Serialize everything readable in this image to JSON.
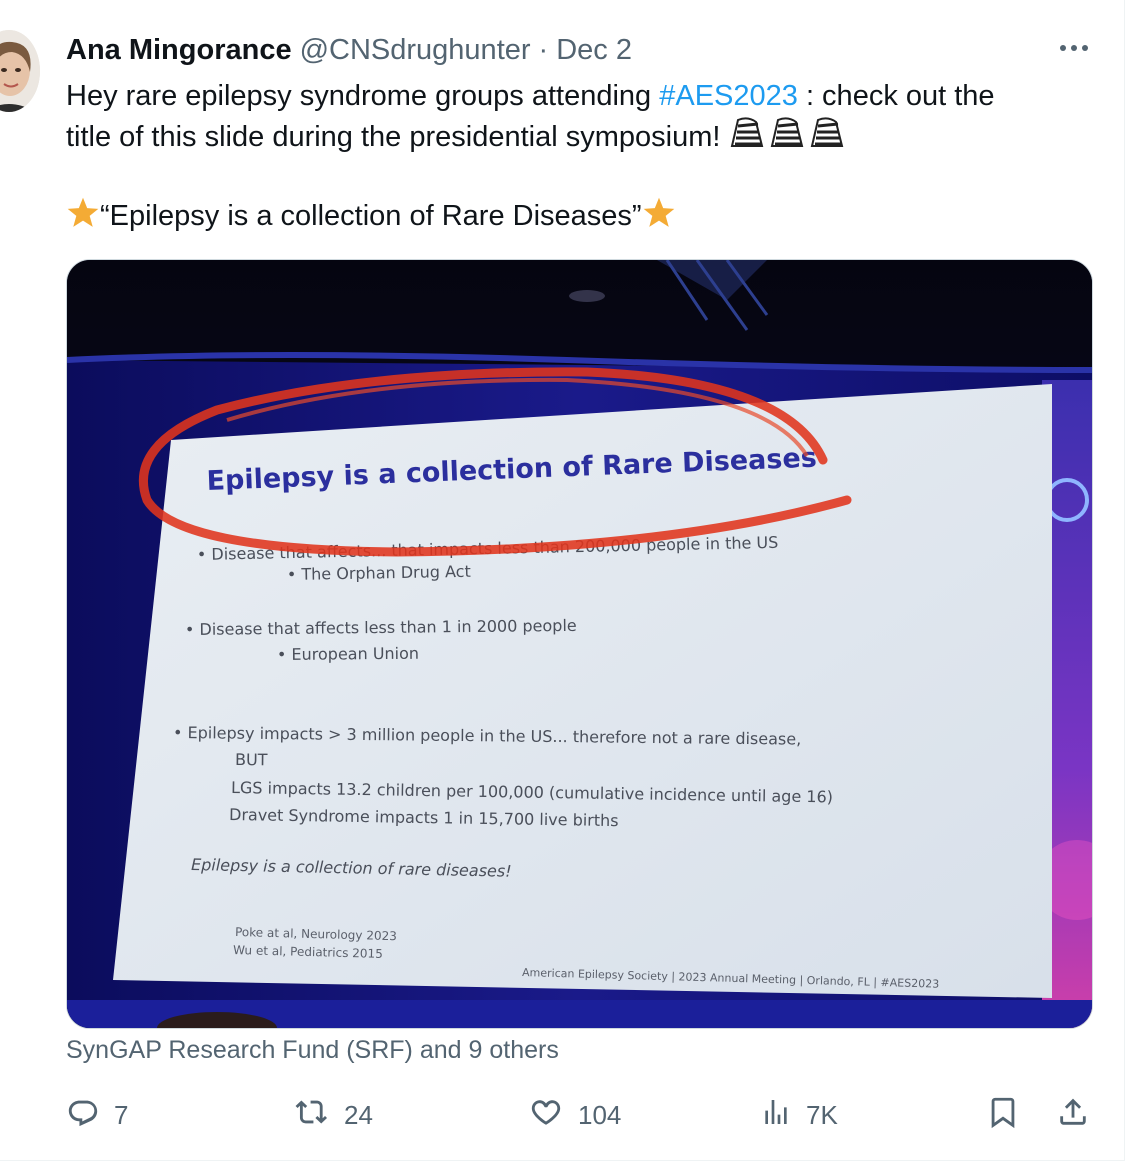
{
  "author": {
    "name": "Ana Mingorance",
    "handle": "@CNSdrughunter",
    "separator": "·",
    "date": "Dec 2"
  },
  "tweet": {
    "line1_before": "Hey rare epilepsy syndrome groups attending ",
    "hashtag": "#AES2023",
    "line1_after": " : check out the",
    "line2": "title of this slide during the presidential symposium! ",
    "quote": "“Epilepsy is a collection of Rare Diseases”"
  },
  "slide": {
    "title": "Epilepsy is a collection of Rare Diseases",
    "bullet1": "• Disease that affects... that impacts less than 200,000 people in the US",
    "bullet1_sub": "•  The Orphan Drug Act",
    "bullet2": "• Disease that affects less than 1 in 2000 people",
    "bullet2_sub": "•  European Union",
    "bullet3": "• Epilepsy impacts > 3 million people in the US... therefore not a rare disease,",
    "but": "BUT",
    "lgs": "LGS impacts 13.2 children per 100,000 (cumulative incidence until age 16)",
    "dravet": "Dravet Syndrome impacts 1 in 15,700 live births",
    "conclusion": "Epilepsy is a collection of rare diseases!",
    "ref1": "Poke at al, Neurology 2023",
    "ref2": "Wu et al, Pediatrics 2015",
    "footer": "American Epilepsy Society  |  2023 Annual Meeting  |  Orlando, FL  |  #AES2023"
  },
  "liked_by": "SynGAP Research Fund (SRF) and 9 others",
  "actions": {
    "replies": "7",
    "reposts": "24",
    "likes": "104",
    "views": "7K"
  },
  "colors": {
    "text": "#0f1419",
    "secondary": "#536471",
    "link": "#1d9bf0",
    "slide_title": "#2b2f9e",
    "marker": "#e0341c"
  },
  "icons": [
    "more-icon",
    "zebra-emoji",
    "star-emoji",
    "reply-icon",
    "repost-icon",
    "like-icon",
    "views-icon",
    "bookmark-icon",
    "share-icon"
  ]
}
